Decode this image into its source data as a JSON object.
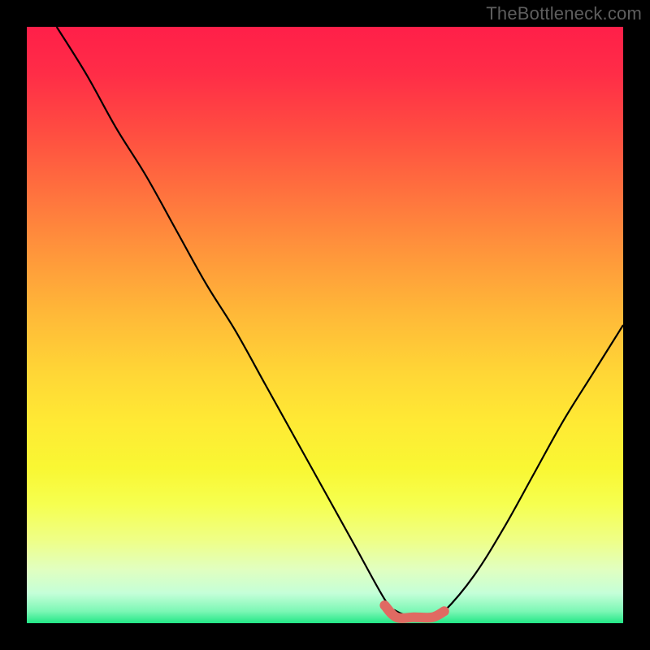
{
  "watermark": {
    "text": "TheBottleneck.com"
  },
  "colors": {
    "background": "#000000",
    "gradient_top": "#ff1f49",
    "gradient_mid": "#ffd636",
    "gradient_bottom": "#22e786",
    "curve": "#000000",
    "highlight": "#e06a62",
    "watermark": "#5e5e5e"
  },
  "chart_data": {
    "type": "line",
    "title": "",
    "xlabel": "",
    "ylabel": "",
    "xlim": [
      0,
      100
    ],
    "ylim": [
      0,
      100
    ],
    "grid": false,
    "series": [
      {
        "name": "bottleneck-curve",
        "x": [
          5,
          10,
          15,
          20,
          25,
          30,
          35,
          40,
          45,
          50,
          55,
          60,
          62,
          65,
          68,
          70,
          75,
          80,
          85,
          90,
          95,
          100
        ],
        "values": [
          100,
          92,
          83,
          75,
          66,
          57,
          49,
          40,
          31,
          22,
          13,
          4,
          2,
          1,
          1,
          2,
          8,
          16,
          25,
          34,
          42,
          50
        ]
      },
      {
        "name": "optimal-range-highlight",
        "x": [
          60,
          62,
          65,
          68,
          70
        ],
        "values": [
          3,
          1,
          1,
          1,
          2
        ]
      }
    ],
    "annotations": []
  }
}
